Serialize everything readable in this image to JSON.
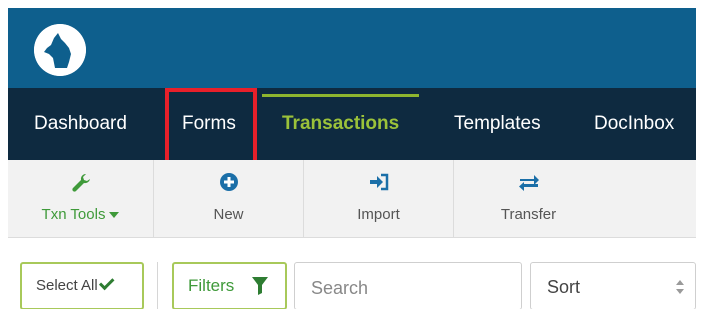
{
  "brand": {
    "logo_icon": "wolf-logo-icon",
    "bar_color": "#0e5f8d"
  },
  "nav": {
    "items": [
      {
        "label": "Dashboard"
      },
      {
        "label": "Forms"
      },
      {
        "label": "Transactions",
        "active": true
      },
      {
        "label": "Templates"
      },
      {
        "label": "DocInbox"
      }
    ],
    "active_color": "#9bc23a",
    "highlight_color": "#e8202a"
  },
  "toolbar": {
    "txn_tools": {
      "label": "Txn Tools",
      "icon": "wrench-icon"
    },
    "new": {
      "label": "New",
      "icon": "plus-circle-icon"
    },
    "import": {
      "label": "Import",
      "icon": "sign-in-icon"
    },
    "transfer": {
      "label": "Transfer",
      "icon": "exchange-arrows-icon"
    }
  },
  "filters": {
    "select_all_label": "Select All",
    "filters_label": "Filters",
    "search_placeholder": "Search",
    "sort_label": "Sort"
  }
}
